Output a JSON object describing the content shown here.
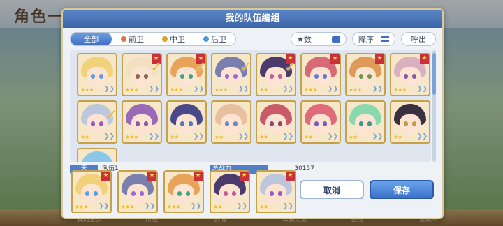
{
  "background": {
    "title": "角色一览",
    "bottom_items": [
      "我的主页",
      "角色",
      "剧情",
      "公会之家",
      "冒险",
      "主菜单"
    ]
  },
  "dialog": {
    "title": "我的队伍编组",
    "tabs": [
      "全部",
      "前卫",
      "中卫",
      "后卫"
    ],
    "stat_button": "★数",
    "sort_button": "降序",
    "call_button": "呼出",
    "team_label": "天",
    "team_name": "队伍1",
    "power_label": "总战力",
    "power_value": "30157",
    "cancel_button": "取消",
    "save_button": "保存"
  },
  "roster": [
    {
      "stars": "★★★",
      "hair": "#f1d27a",
      "eye": "#5aa0e0",
      "flag": false,
      "check": false
    },
    {
      "stars": "★★★",
      "hair": "#f3e0c0",
      "eye": "#8a6a4a",
      "flag": true,
      "check": true
    },
    {
      "stars": "★★★",
      "hair": "#e7a35a",
      "eye": "#3fa67a",
      "flag": true,
      "check": true
    },
    {
      "stars": "★★★",
      "hair": "#7b7fae",
      "eye": "#9a6ad0",
      "flag": false,
      "check": true
    },
    {
      "stars": "★★",
      "hair": "#4b3a6c",
      "eye": "#c55a9a",
      "flag": true,
      "check": true
    },
    {
      "stars": "★★★",
      "hair": "#d86a78",
      "eye": "#6a7ad0",
      "flag": true,
      "check": false
    },
    {
      "stars": "★★★",
      "hair": "#e09a58",
      "eye": "#6a9a4a",
      "flag": true,
      "check": false
    },
    {
      "stars": "★★★",
      "hair": "#d8b0c0",
      "eye": "#8a5aa0",
      "flag": true,
      "check": false
    },
    {
      "stars": "★★",
      "hair": "#bcc6dc",
      "eye": "#9a5ac0",
      "flag": false,
      "check": true
    },
    {
      "stars": "★★★",
      "hair": "#9a6ab8",
      "eye": "#8a5aa0",
      "flag": false,
      "check": false
    },
    {
      "stars": "★★",
      "hair": "#4a4a8a",
      "eye": "#4a7ac0",
      "flag": false,
      "check": false
    },
    {
      "stars": "★★",
      "hair": "#e8c0a0",
      "eye": "#6a8ac0",
      "flag": false,
      "check": false
    },
    {
      "stars": "★★",
      "hair": "#c85a6a",
      "eye": "#8a4a6a",
      "flag": false,
      "check": false
    },
    {
      "stars": "★★",
      "hair": "#e06a7a",
      "eye": "#7a5ac0",
      "flag": false,
      "check": false
    },
    {
      "stars": "★★",
      "hair": "#8ad8b0",
      "eye": "#3a9a8a",
      "flag": false,
      "check": false
    },
    {
      "stars": "★★",
      "hair": "#3a3040",
      "eye": "#c09a4a",
      "flag": false,
      "check": false
    },
    {
      "stars": "★★",
      "hair": "#8ac8e8",
      "eye": "#4a8ac0",
      "flag": false,
      "check": false
    }
  ],
  "team": [
    {
      "stars": "★★★",
      "hair": "#f1d27a",
      "eye": "#5aa0e0",
      "flag": true
    },
    {
      "stars": "★★★",
      "hair": "#7b7fae",
      "eye": "#9a6ad0",
      "flag": true
    },
    {
      "stars": "★★★",
      "hair": "#e7a35a",
      "eye": "#3fa67a",
      "flag": true
    },
    {
      "stars": "★★",
      "hair": "#4b3a6c",
      "eye": "#c55a9a",
      "flag": true
    },
    {
      "stars": "★★",
      "hair": "#bcc6dc",
      "eye": "#9a5ac0",
      "flag": true
    }
  ]
}
